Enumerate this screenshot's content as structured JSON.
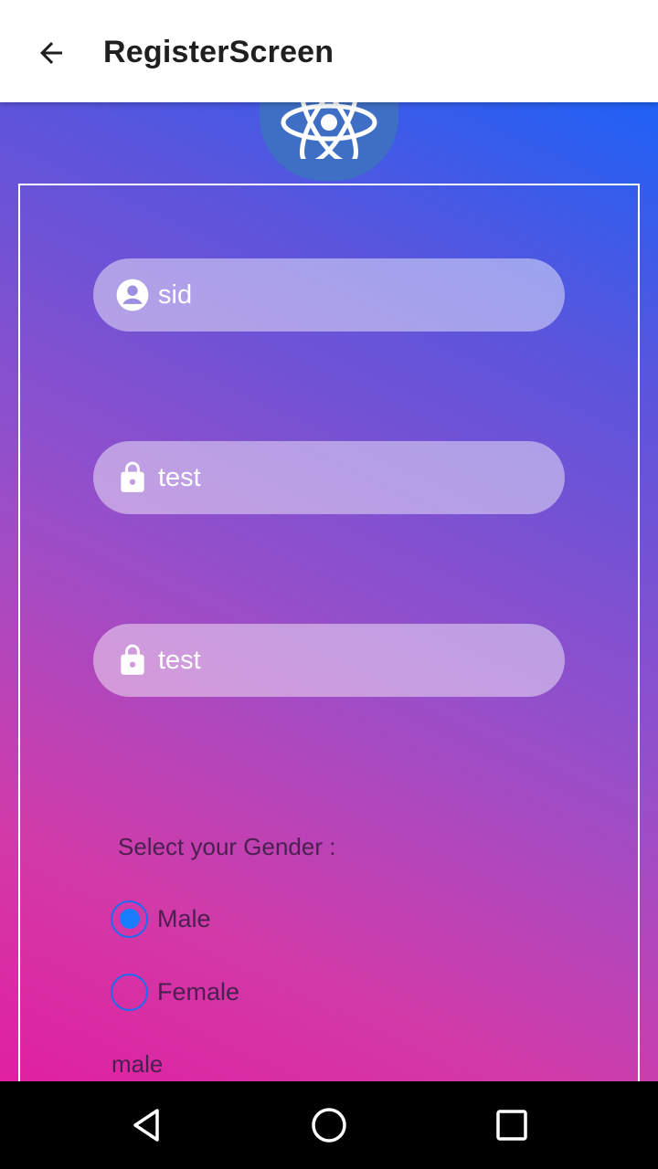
{
  "appbar": {
    "title": "RegisterScreen",
    "back_icon": "arrow-left-icon"
  },
  "logo": {
    "icon": "react-atom-icon",
    "color": "#3f6fc4"
  },
  "form": {
    "username": {
      "value": "sid",
      "icon": "account-circle-icon"
    },
    "password": {
      "value": "test",
      "icon": "lock-icon"
    },
    "confirm_password": {
      "value": "test",
      "icon": "lock-icon"
    }
  },
  "gender": {
    "label": "Select your Gender :",
    "options": [
      {
        "label": "Male",
        "selected": true
      },
      {
        "label": "Female",
        "selected": false
      }
    ],
    "selected_value": "male"
  },
  "navbar": {
    "back": "nav-back-icon",
    "home": "nav-home-icon",
    "recents": "nav-recents-icon"
  },
  "colors": {
    "gradient_top": "#0a66ff",
    "gradient_bottom": "#e020a0",
    "radio_accent": "#1a7cff",
    "text_dark": "#4a2050"
  }
}
